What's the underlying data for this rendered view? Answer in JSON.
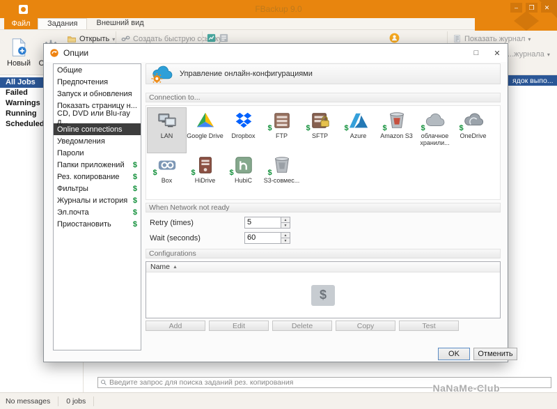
{
  "window": {
    "title": "FBackup 9.0"
  },
  "menu": {
    "file": "Файл",
    "tabs": [
      "Задания",
      "Внешний вид"
    ]
  },
  "ribbon": {
    "new": "Новый",
    "properties": "Свой...",
    "open": "Открыть",
    "quick_link": "Создать быструю ссылку...",
    "show_log": "Показать журнал",
    "log_partial": "...журнала"
  },
  "sidebar": {
    "items": [
      {
        "key": "all-jobs",
        "label": "All Jobs",
        "selected": true
      },
      {
        "key": "failed",
        "label": "Failed"
      },
      {
        "key": "warnings",
        "label": "Warnings"
      },
      {
        "key": "running",
        "label": "Running"
      },
      {
        "key": "scheduled",
        "label": "Scheduled"
      }
    ]
  },
  "jobs": {
    "header_partial": "ядок выпо..."
  },
  "search": {
    "placeholder": "Введите запрос для поиска заданий рез. копирования"
  },
  "statusbar": {
    "messages": "No messages",
    "jobs": "0 jobs"
  },
  "watermark": "NaNaMe-Club",
  "colors": {
    "accent": "#E8850E",
    "accent-dark": "#D3770B",
    "selection-blue": "#2B5797",
    "pro-green": "#14913C",
    "list-selection": "#3D3D3D"
  },
  "dialog": {
    "title": "Опции",
    "pro_badge": "$",
    "header": "Управление онлайн-конфигурациями",
    "categories": [
      {
        "key": "general",
        "label": "Общие"
      },
      {
        "key": "preferences",
        "label": "Предпочтения"
      },
      {
        "key": "startup-updates",
        "label": "Запуск и обновления"
      },
      {
        "key": "startup-page",
        "label": "Показать страницу н..."
      },
      {
        "key": "cd-dvd-bluray",
        "label": "CD, DVD или Blu-ray д..."
      },
      {
        "key": "online-connections",
        "label": "Online connections",
        "selected": true
      },
      {
        "key": "notifications",
        "label": "Уведомления"
      },
      {
        "key": "passwords",
        "label": "Пароли"
      },
      {
        "key": "application-folders",
        "label": "Папки приложений",
        "pro": true
      },
      {
        "key": "backup",
        "label": "Рез. копирование",
        "pro": true
      },
      {
        "key": "filters",
        "label": "Фильтры",
        "pro": true
      },
      {
        "key": "logs-history",
        "label": "Журналы и история",
        "pro": true
      },
      {
        "key": "email",
        "label": "Эл.почта",
        "pro": true
      },
      {
        "key": "suspend",
        "label": "Приостановить",
        "pro": true
      }
    ],
    "sections": {
      "connection": "Connection to...",
      "network": "When Network not ready",
      "configurations": "Configurations"
    },
    "connections": [
      {
        "key": "lan",
        "label": "LAN",
        "selected": true
      },
      {
        "key": "google-drive",
        "label": "Google Drive"
      },
      {
        "key": "dropbox",
        "label": "Dropbox"
      },
      {
        "key": "ftp",
        "label": "FTP",
        "pro": true
      },
      {
        "key": "sftp",
        "label": "SFTP",
        "pro": true
      },
      {
        "key": "azure",
        "label": "Azure",
        "pro": true
      },
      {
        "key": "amazon-s3",
        "label": "Amazon S3",
        "pro": true
      },
      {
        "key": "cloud-storage",
        "label": "облачное хранили...",
        "pro": true
      },
      {
        "key": "onedrive",
        "label": "OneDrive",
        "pro": true
      },
      {
        "key": "box",
        "label": "Box",
        "pro": true
      },
      {
        "key": "hidrive",
        "label": "HiDrive",
        "pro": true
      },
      {
        "key": "hubic",
        "label": "HubiC",
        "pro": true
      },
      {
        "key": "s3-compatible",
        "label": "S3-совмес...",
        "pro": true
      }
    ],
    "network": {
      "retry_label": "Retry (times)",
      "retry_value": "5",
      "wait_label": "Wait (seconds)",
      "wait_value": "60"
    },
    "config_list": {
      "column": "Name",
      "sort_icon": "▲"
    },
    "config_buttons": [
      {
        "key": "add",
        "label": "Add"
      },
      {
        "key": "edit",
        "label": "Edit"
      },
      {
        "key": "delete",
        "label": "Delete"
      },
      {
        "key": "copy",
        "label": "Copy"
      },
      {
        "key": "test",
        "label": "Test"
      }
    ],
    "ok": "OK",
    "cancel": "Отменить"
  }
}
